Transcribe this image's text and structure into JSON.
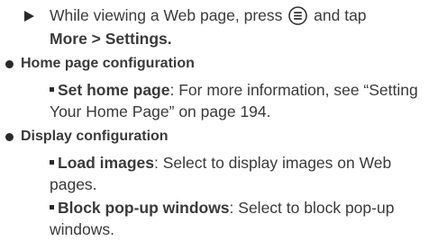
{
  "step": {
    "text_before": "While viewing a Web page, press ",
    "text_after": " and tap",
    "path": "More > Settings."
  },
  "sections": [
    {
      "heading": "Home page configuration",
      "items": [
        {
          "term": "Set home page",
          "desc_line1": ": For more information, see “Setting",
          "desc_line2": "Your Home Page” on page 194."
        }
      ]
    },
    {
      "heading": "Display configuration",
      "items": [
        {
          "term": "Load images",
          "desc_line1": ": Select to display images on Web",
          "desc_line2": "pages."
        },
        {
          "term": "Block pop-up windows",
          "desc_line1": ": Select to block pop-up",
          "desc_line2": "windows."
        }
      ]
    }
  ],
  "icons": {
    "bullet_step": "triangle-bullet-icon",
    "menu_key": "menu-key-icon"
  }
}
